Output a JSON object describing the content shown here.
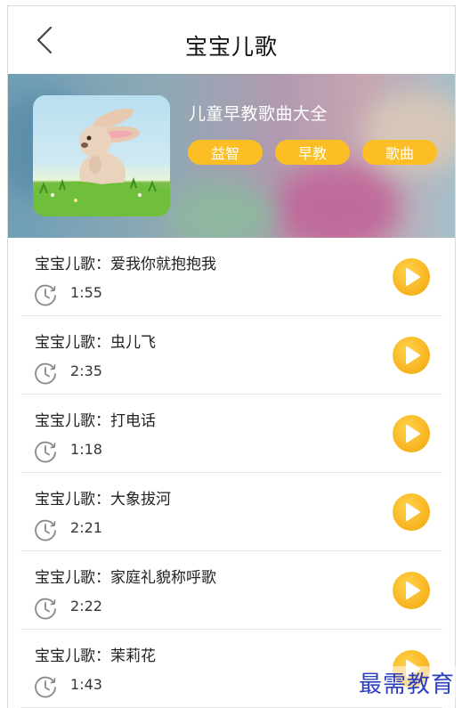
{
  "header": {
    "title": "宝宝儿歌",
    "back_icon": "chevron-left-icon"
  },
  "album": {
    "name": "儿童早教歌曲大全",
    "tags": [
      "益智",
      "早教",
      "歌曲"
    ],
    "cover_icon": "bunny-cover-image"
  },
  "songs": [
    {
      "title": "宝宝儿歌：爱我你就抱抱我",
      "duration": "1:55"
    },
    {
      "title": "宝宝儿歌：虫儿飞",
      "duration": "2:35"
    },
    {
      "title": "宝宝儿歌：打电话",
      "duration": "1:18"
    },
    {
      "title": "宝宝儿歌：大象拔河",
      "duration": "2:21"
    },
    {
      "title": "宝宝儿歌：家庭礼貌称呼歌",
      "duration": "2:22"
    },
    {
      "title": "宝宝儿歌：茉莉花",
      "duration": "1:43"
    }
  ],
  "watermark": "最需教育",
  "colors": {
    "accent": "#fbbf25",
    "play": "#f7b21c",
    "watermark": "#2b3fbf"
  }
}
